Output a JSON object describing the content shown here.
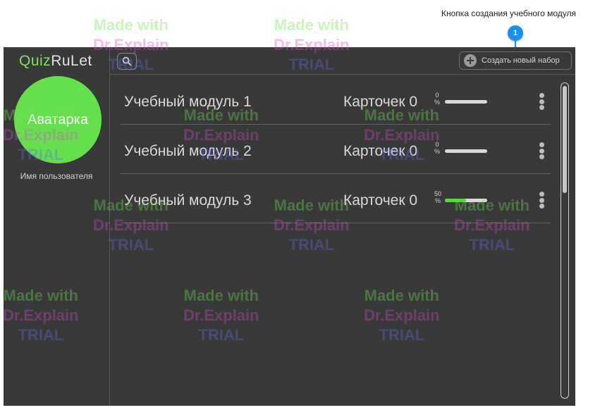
{
  "annotation": {
    "callout_text": "Кнопка создания учебного модуля",
    "callout_number": "1"
  },
  "sidebar": {
    "logo_part1": "Quiz",
    "logo_part2": "RuLet",
    "avatar_label": "Аватарка",
    "username": "Имя пользователя"
  },
  "topbar": {
    "search_icon": "search-icon",
    "create_button_label": "Создать новый набор",
    "create_icon": "plus-circle-icon"
  },
  "modules": [
    {
      "title": "Учебный модуль 1",
      "cards_label": "Карточек 0",
      "percent": "0",
      "percent_unit": "%",
      "progress": 0
    },
    {
      "title": "Учебный модуль 2",
      "cards_label": "Карточек 0",
      "percent": "0",
      "percent_unit": "%",
      "progress": 0
    },
    {
      "title": "Учебный модуль 3",
      "cards_label": "Карточек 0",
      "percent": "50",
      "percent_unit": "%",
      "progress": 0.5
    }
  ],
  "watermark": {
    "line1": "Made with",
    "line2": "Dr.Explain",
    "line3": "TRIAL"
  },
  "colors": {
    "background": "#3a3939",
    "accent_green": "#65e04c",
    "progress_green": "#59d43a",
    "callout_blue": "#1a8ff0"
  }
}
